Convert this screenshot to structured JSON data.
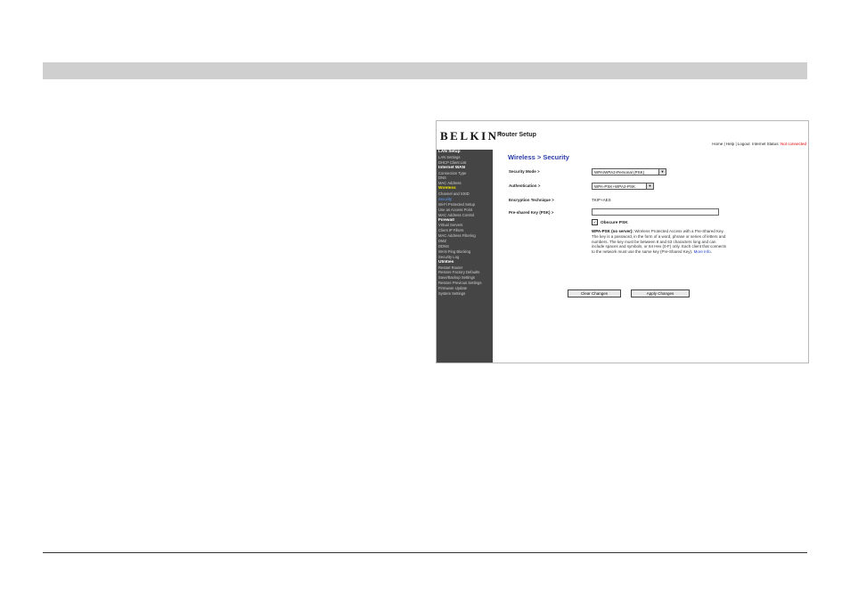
{
  "router": {
    "brand": "BELKIN",
    "brand_mark": "®",
    "app_title": "Router Setup",
    "top_links": {
      "home": "Home",
      "help": "Help",
      "logout": "Logout",
      "separator": "|",
      "status_label": "Internet Status:",
      "status_value": "Not connected",
      "status_color": "#e00000"
    },
    "sidebar": [
      {
        "label": "LAN Setup",
        "kind": "section"
      },
      {
        "label": "LAN Settings",
        "kind": "item"
      },
      {
        "label": "DHCP Client List",
        "kind": "item"
      },
      {
        "label": "Internet WAN",
        "kind": "section"
      },
      {
        "label": "Connection Type",
        "kind": "item"
      },
      {
        "label": "DNS",
        "kind": "item"
      },
      {
        "label": "MAC Address",
        "kind": "item"
      },
      {
        "label": "Wireless",
        "kind": "active-section"
      },
      {
        "label": "Channel and SSID",
        "kind": "item"
      },
      {
        "label": "Security",
        "kind": "active-item"
      },
      {
        "label": "Wi-Fi Protected Setup",
        "kind": "item"
      },
      {
        "label": "Use as Access Point",
        "kind": "item"
      },
      {
        "label": "MAC Address Control",
        "kind": "item"
      },
      {
        "label": "Firewall",
        "kind": "section"
      },
      {
        "label": "Virtual Servers",
        "kind": "item"
      },
      {
        "label": "Client IP Filters",
        "kind": "item"
      },
      {
        "label": "MAC Address Filtering",
        "kind": "item"
      },
      {
        "label": "DMZ",
        "kind": "item"
      },
      {
        "label": "DDNS",
        "kind": "item"
      },
      {
        "label": "WAN Ping Blocking",
        "kind": "item"
      },
      {
        "label": "Security Log",
        "kind": "item"
      },
      {
        "label": "Utilities",
        "kind": "section"
      },
      {
        "label": "Restart Router",
        "kind": "item"
      },
      {
        "label": "Restore Factory Defaults",
        "kind": "item"
      },
      {
        "label": "Save/Backup Settings",
        "kind": "item"
      },
      {
        "label": "Restore Previous Settings",
        "kind": "item"
      },
      {
        "label": "Firmware Update",
        "kind": "item"
      },
      {
        "label": "System Settings",
        "kind": "item"
      }
    ],
    "main": {
      "title": "Wireless > Security",
      "security_mode_label": "Security Mode >",
      "security_mode_value": "WPA/WPA2-Personal (PSK)",
      "authentication_label": "Authentication >",
      "authentication_value": "WPA-PSK+WPA2-PSK",
      "encryption_label": "Encryption Technique >",
      "encryption_value": "TKIP+AES",
      "psk_label": "Pre-shared Key (PSK) >",
      "psk_value": "",
      "obscure_label": "Obscure PSK",
      "obscure_checked": true,
      "help_bold": "WPA-PSK (no server):",
      "help_text": " Wireless Protected Access with a Pre-Shared Key. The key is a password, in the form of a word, phrase or series of letters and numbers. The key must be between 8 and 63 characters long and can include spaces and symbols, or 64 Hex (0-F) only. Each client that connects to the network must use the same key (Pre-Shared Key).",
      "help_link": "More Info",
      "clear_button": "Clear Changes",
      "apply_button": "Apply Changes"
    }
  },
  "colors": {
    "top_bar": "#cfcfcf",
    "sidebar_bg": "#454545",
    "title_blue": "#2a3aa8",
    "active_section": "#f2e600",
    "active_item": "#5aa0ff"
  }
}
